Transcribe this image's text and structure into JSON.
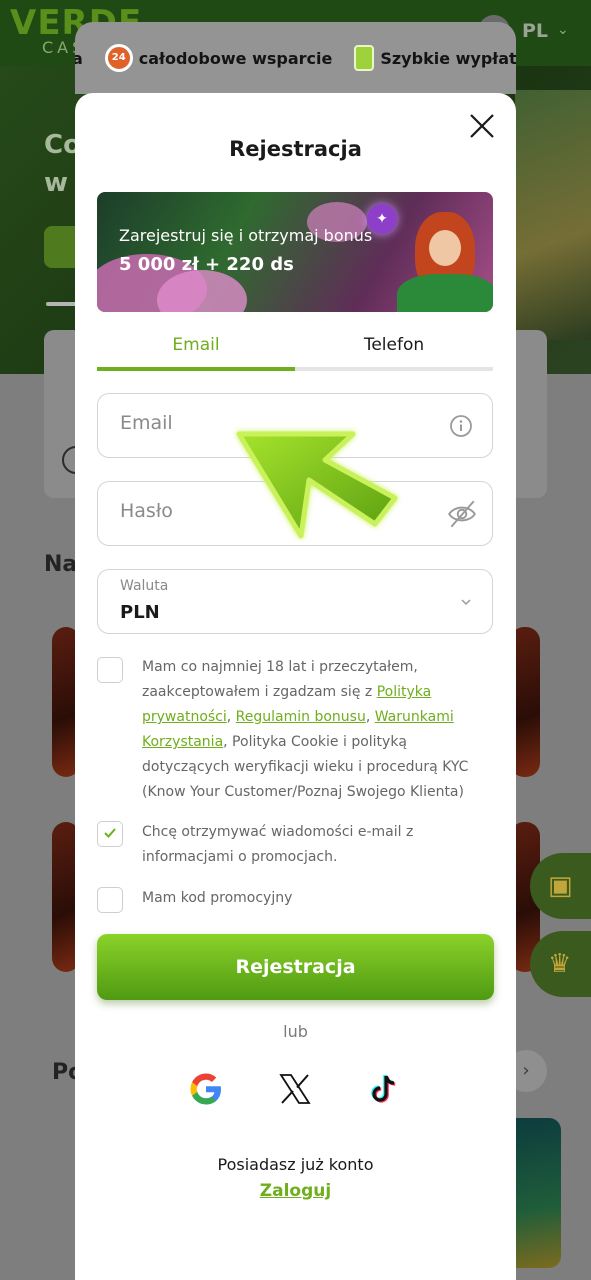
{
  "background": {
    "logo": "VERDE",
    "logo_sub": "CASINO",
    "language": "PL",
    "hero_text": "Co\nw",
    "section_heading_1": "Na",
    "section_heading_2": "Po"
  },
  "features": [
    {
      "icon": "cash-icon",
      "label": "cja"
    },
    {
      "icon": "support-24-icon",
      "label": "całodobowe wsparcie",
      "icon_text": "24"
    },
    {
      "icon": "cash-icon",
      "label": "Szybkie wypłat"
    }
  ],
  "modal": {
    "title": "Rejestracja",
    "banner": {
      "line1": "Zarejestruj się i otrzymaj bonus",
      "line2": "5 000 zł + 220 ds"
    },
    "tabs": [
      {
        "label": "Email",
        "active": true
      },
      {
        "label": "Telefon",
        "active": false
      }
    ],
    "fields": {
      "email_placeholder": "Email",
      "password_placeholder": "Hasło",
      "currency_label": "Waluta",
      "currency_value": "PLN"
    },
    "terms": {
      "checked": false,
      "part1": "Mam co najmniej 18 lat i przeczytałem, zaakceptowałem i zgadzam się z ",
      "link1": "Polityka prywatności",
      "sep1": ", ",
      "link2": "Regulamin bonusu",
      "sep2": ", ",
      "link3": "Warunkami Korzystania",
      "part2": ", Polityka Cookie i polityką dotyczących weryfikacji wieku i procedurą KYC (Know Your Customer/Poznaj Swojego Klienta)"
    },
    "newsletter": {
      "checked": true,
      "text": "Chcę otrzymywać wiadomości e-mail z informacjami o promocjach."
    },
    "promo": {
      "checked": false,
      "text": "Mam kod promocyjny"
    },
    "submit_label": "Rejestracja",
    "or_label": "lub",
    "social": [
      "google-icon",
      "x-icon",
      "tiktok-icon"
    ],
    "have_account": "Posiadasz już konto",
    "login_label": "Zaloguj"
  },
  "colors": {
    "accent": "#6fae1c",
    "button_top": "#8bd22a",
    "button_bottom": "#4f9a12",
    "arrow": "#7ec21d"
  }
}
